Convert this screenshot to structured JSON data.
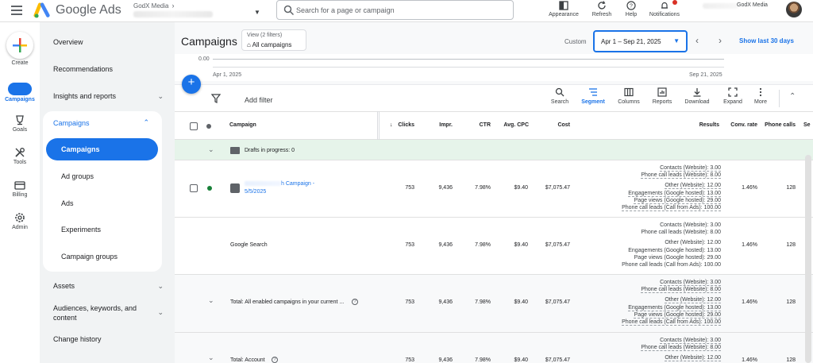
{
  "app": {
    "title": "Google Ads",
    "account_name": "GodX Media",
    "search_placeholder": "Search for a page or campaign",
    "user_name": "GodX Media"
  },
  "top_actions": [
    {
      "label": "Appearance",
      "icon": "appearance-icon"
    },
    {
      "label": "Refresh",
      "icon": "refresh-icon"
    },
    {
      "label": "Help",
      "icon": "help-icon"
    },
    {
      "label": "Notifications",
      "icon": "notifications-icon"
    }
  ],
  "rail": {
    "create_label": "Create",
    "items": [
      {
        "label": "Campaigns",
        "icon": "campaigns-icon",
        "active": true
      },
      {
        "label": "Goals",
        "icon": "goals-icon"
      },
      {
        "label": "Tools",
        "icon": "tools-icon"
      },
      {
        "label": "Billing",
        "icon": "billing-icon"
      },
      {
        "label": "Admin",
        "icon": "admin-icon"
      }
    ]
  },
  "nav": {
    "overview": "Overview",
    "recommendations": "Recommendations",
    "insights": "Insights and reports",
    "campaigns_section": "Campaigns",
    "campaigns_sub": [
      "Campaigns",
      "Ad groups",
      "Ads",
      "Experiments",
      "Campaign groups"
    ],
    "assets": "Assets",
    "audiences_line1": "Audiences, keywords, and",
    "audiences_line2": "content",
    "change_history": "Change history"
  },
  "header": {
    "title": "Campaigns",
    "view_count": "View (2 filters)",
    "view_name": "All campaigns",
    "custom_label": "Custom",
    "date_range": "Apr 1 – Sep 21, 2025",
    "show_last": "Show last 30 days"
  },
  "chart": {
    "zero_label": "0.00",
    "start_date": "Apr 1, 2025",
    "end_date": "Sep 21, 2025"
  },
  "toolbar": {
    "add_filter": "Add filter",
    "buttons": [
      {
        "label": "Search",
        "icon": "search-icon"
      },
      {
        "label": "Segment",
        "icon": "segment-icon",
        "active": true
      },
      {
        "label": "Columns",
        "icon": "columns-icon"
      },
      {
        "label": "Reports",
        "icon": "reports-icon"
      },
      {
        "label": "Download",
        "icon": "download-icon"
      },
      {
        "label": "Expand",
        "icon": "expand-icon"
      },
      {
        "label": "More",
        "icon": "more-icon"
      }
    ]
  },
  "table": {
    "headers": {
      "campaign": "Campaign",
      "clicks": "Clicks",
      "impr": "Impr.",
      "ctr": "CTR",
      "avg_cpc": "Avg. CPC",
      "cost": "Cost",
      "results": "Results",
      "conv_rate": "Conv. rate",
      "phone_calls": "Phone calls",
      "extra": "Se"
    },
    "drafts": "Drafts in progress: 0",
    "rows": [
      {
        "name_suffix": "h Campaign -",
        "name_line2": "5/5/2025",
        "clicks": "753",
        "impr": "9,436",
        "ctr": "7.98%",
        "avg_cpc": "$9.40",
        "cost": "$7,075.47",
        "results": [
          "Contacts (Website): 3.00",
          "Phone call leads (Website): 8.00",
          "",
          "Other (Website): 12.00",
          "Engagements (Google hosted): 13.00",
          "Page views (Google hosted): 29.00",
          "Phone call leads (Call from Ads): 100.00"
        ],
        "conv_rate": "1.46%",
        "phone_calls": "128"
      },
      {
        "name": "Google Search",
        "clicks": "753",
        "impr": "9,436",
        "ctr": "7.98%",
        "avg_cpc": "$9.40",
        "cost": "$7,075.47",
        "results": [
          "Contacts (Website): 3.00",
          "Phone call leads (Website): 8.00",
          "",
          "Other (Website): 12.00",
          "Engagements (Google hosted): 13.00",
          "Page views (Google hosted): 29.00",
          "Phone call leads (Call from Ads): 100.00"
        ],
        "conv_rate": "1.46%",
        "phone_calls": "128"
      },
      {
        "name": "Total: All enabled campaigns in your current ...",
        "clicks": "753",
        "impr": "9,436",
        "ctr": "7.98%",
        "avg_cpc": "$9.40",
        "cost": "$7,075.47",
        "results": [
          "Contacts (Website): 3.00",
          "Phone call leads (Website): 8.00",
          "",
          "Other (Website): 12.00",
          "Engagements (Google hosted): 13.00",
          "Page views (Google hosted): 29.00",
          "Phone call leads (Call from Ads): 100.00"
        ],
        "conv_rate": "1.46%",
        "phone_calls": "128"
      },
      {
        "name": "Total: Account",
        "clicks": "753",
        "impr": "9,436",
        "ctr": "7.98%",
        "avg_cpc": "$9.40",
        "cost": "$7,075.47",
        "results": [
          "Contacts (Website): 3.00",
          "Phone call leads (Website): 8.00",
          "",
          "Other (Website): 12.00"
        ],
        "conv_rate": "1.46%",
        "phone_calls": "128"
      }
    ]
  },
  "colors": {
    "accent": "#1a73e8",
    "enabled_dot": "#188038",
    "draft_bg": "#e6f4ea"
  }
}
